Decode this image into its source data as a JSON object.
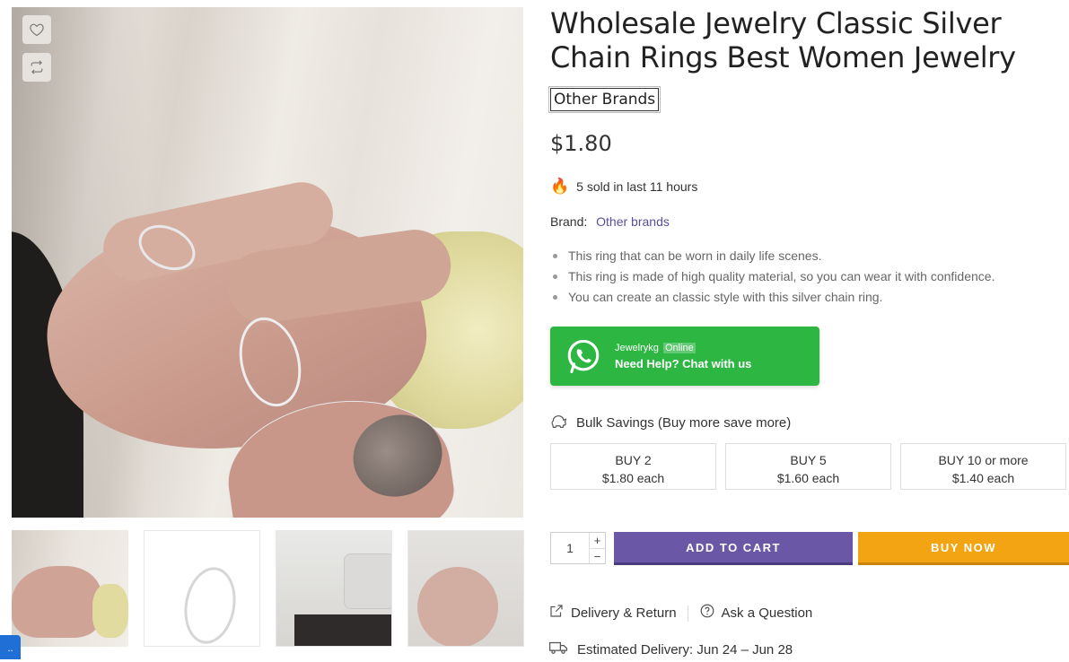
{
  "product": {
    "title": "Wholesale Jewelry Classic Silver Chain Rings Best Women Jewelry",
    "brand_badge": "Other Brands",
    "price": "$1.80",
    "sold_text": "5 sold in last 11 hours",
    "brand_label": "Brand:",
    "brand_value": "Other brands",
    "features": [
      "This ring that can be worn in daily life scenes.",
      "This ring is made of high quality material, so you can wear it with confidence.",
      "You can create an classic style with this silver chain ring."
    ]
  },
  "whatsapp": {
    "name": "Jewelrykg",
    "status": "Online",
    "cta": "Need Help? Chat with us",
    "color": "#2db742"
  },
  "bulk": {
    "heading": "Bulk Savings (Buy more save more)",
    "tiers": [
      {
        "qty": "BUY 2",
        "price": "$1.80 each"
      },
      {
        "qty": "BUY 5",
        "price": "$1.60 each"
      },
      {
        "qty": "BUY 10 or more",
        "price": "$1.40 each"
      }
    ]
  },
  "purchase": {
    "quantity": "1",
    "plus": "+",
    "minus": "−",
    "add_to_cart": "ADD TO CART",
    "buy_now": "BUY NOW",
    "cart_color": "#6a58a6",
    "buy_color": "#f2a413"
  },
  "links": {
    "delivery_return": "Delivery & Return",
    "ask_question": "Ask a Question"
  },
  "delivery": {
    "estimated": "Estimated Delivery: Jun 24 – Jun 28"
  },
  "gallery": {
    "wishlist_icon": "heart-icon",
    "compare_icon": "compare-icon",
    "thumbnail_count": 4
  },
  "edge_tab": {
    "label": ".."
  }
}
